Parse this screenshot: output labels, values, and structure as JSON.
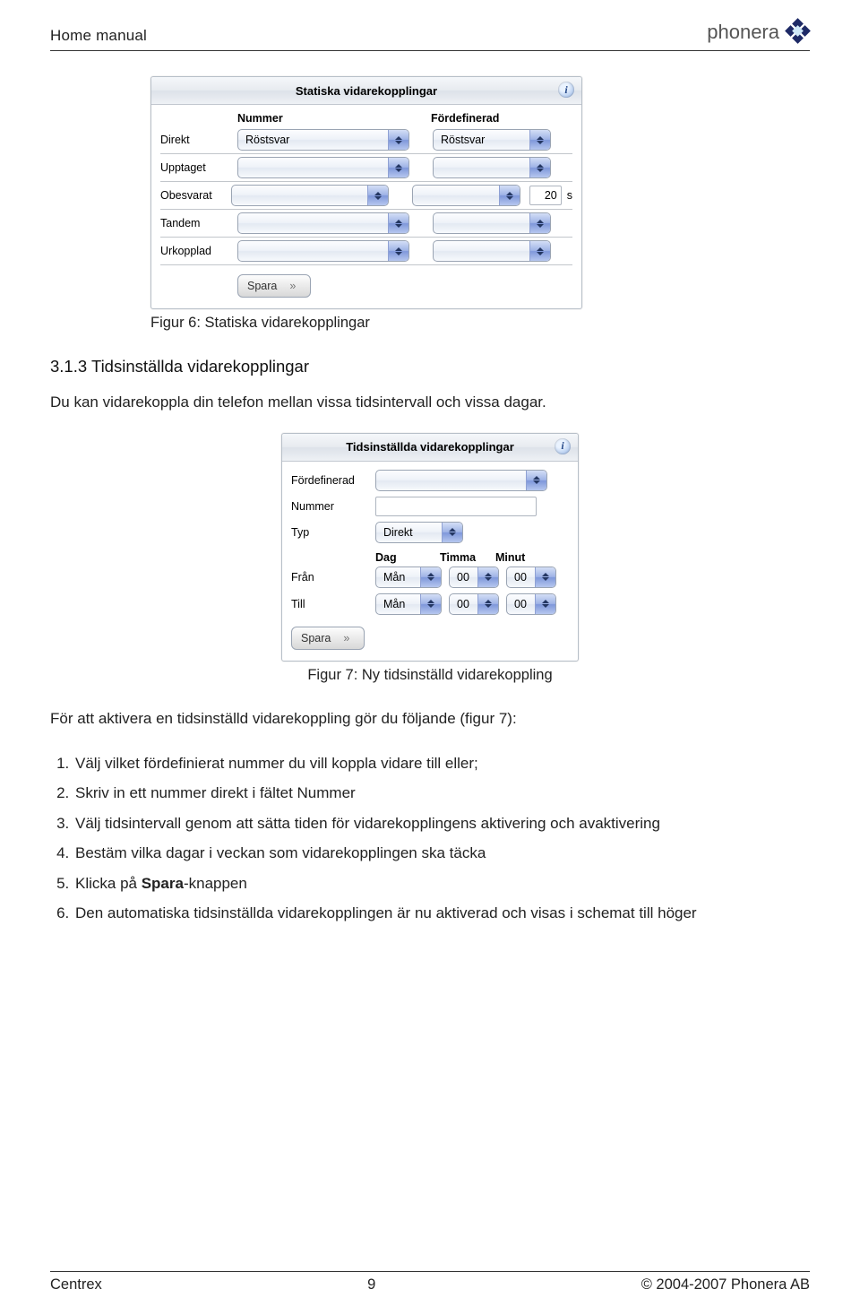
{
  "header": {
    "title": "Home manual",
    "brand": "phonera"
  },
  "panel1": {
    "title": "Statiska vidarekopplingar",
    "columns": {
      "nummer": "Nummer",
      "fordefinerad": "Fördefinerad"
    },
    "rows": {
      "direkt": {
        "label": "Direkt",
        "nummer": "Röstsvar",
        "fordef": "Röstsvar"
      },
      "upptaget": {
        "label": "Upptaget",
        "nummer": "",
        "fordef": ""
      },
      "obesvarat": {
        "label": "Obesvarat",
        "nummer": "",
        "fordef": "",
        "sec": "20",
        "unit": "s"
      },
      "tandem": {
        "label": "Tandem",
        "nummer": "",
        "fordef": ""
      },
      "urkopplad": {
        "label": "Urkopplad",
        "nummer": "",
        "fordef": ""
      }
    },
    "save": "Spara"
  },
  "fig6": "Figur 6: Statiska vidarekopplingar",
  "section": {
    "heading": "3.1.3 Tidsinställda vidarekopplingar",
    "intro": "Du kan vidarekoppla din telefon mellan vissa tidsintervall och vissa dagar."
  },
  "panel2": {
    "title": "Tidsinställda vidarekopplingar",
    "labels": {
      "fordef": "Fördefinerad",
      "nummer": "Nummer",
      "typ": "Typ",
      "fran": "Från",
      "till": "Till"
    },
    "typ_value": "Direkt",
    "columns": {
      "dag": "Dag",
      "timma": "Timma",
      "minut": "Minut"
    },
    "from": {
      "dag": "Mån",
      "timma": "00",
      "minut": "00"
    },
    "to": {
      "dag": "Mån",
      "timma": "00",
      "minut": "00"
    },
    "save": "Spara"
  },
  "fig7": "Figur 7: Ny tidsinställd vidarekoppling",
  "activate_intro": "För att aktivera en tidsinställd vidarekoppling gör du följande (figur 7):",
  "steps": {
    "s1": "Välj vilket fördefinierat nummer du vill koppla vidare till eller;",
    "s2": "Skriv in ett nummer direkt i fältet Nummer",
    "s3": "Välj tidsintervall genom att sätta tiden för vidarekopplingens aktivering och avaktivering",
    "s4": "Bestäm vilka dagar i veckan som vidarekopplingen ska täcka",
    "s5_a": "Klicka på ",
    "s5_b": "Spara",
    "s5_c": "-knappen",
    "s6": "Den automatiska tidsinställda vidarekopplingen är nu aktiverad och visas i schemat till höger"
  },
  "footer": {
    "left": "Centrex",
    "center": "9",
    "right": "© 2004-2007 Phonera AB"
  }
}
